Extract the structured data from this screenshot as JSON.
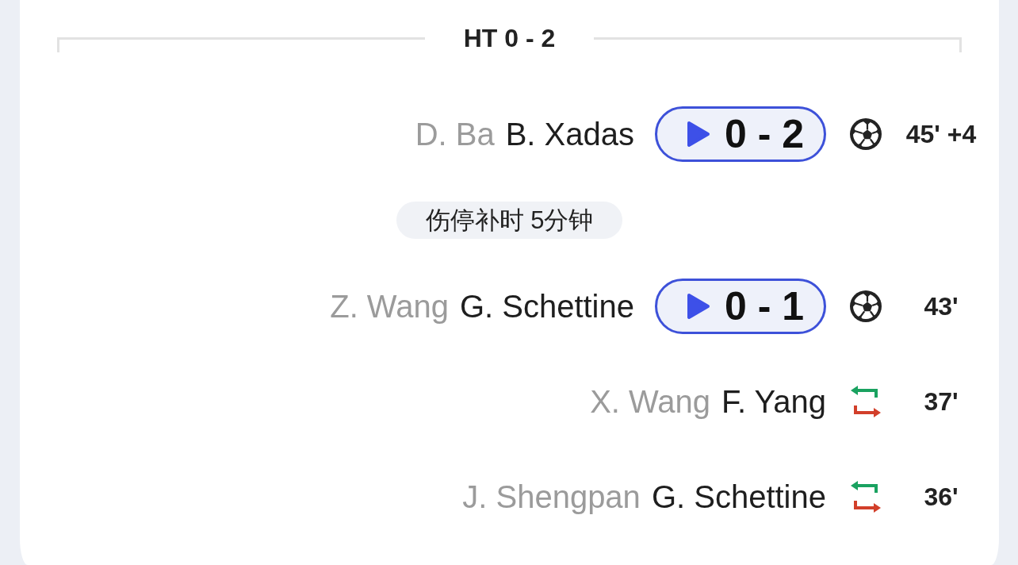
{
  "header": {
    "title": "HT 0 - 2"
  },
  "events": [
    {
      "kind": "goal",
      "player": "B. Xadas",
      "secondary_player": "D. Ba",
      "score": "0 - 2",
      "time": "45' +4"
    },
    {
      "kind": "note",
      "text": "伤停补时 5分钟"
    },
    {
      "kind": "goal",
      "player": "G. Schettine",
      "secondary_player": "Z. Wang",
      "score": "0 - 1",
      "time": "43'"
    },
    {
      "kind": "substitution",
      "player": "F. Yang",
      "secondary_player": "X. Wang",
      "time": "37'"
    },
    {
      "kind": "substitution",
      "player": "G. Schettine",
      "secondary_player": "J. Shengpan",
      "time": "36'"
    }
  ]
}
